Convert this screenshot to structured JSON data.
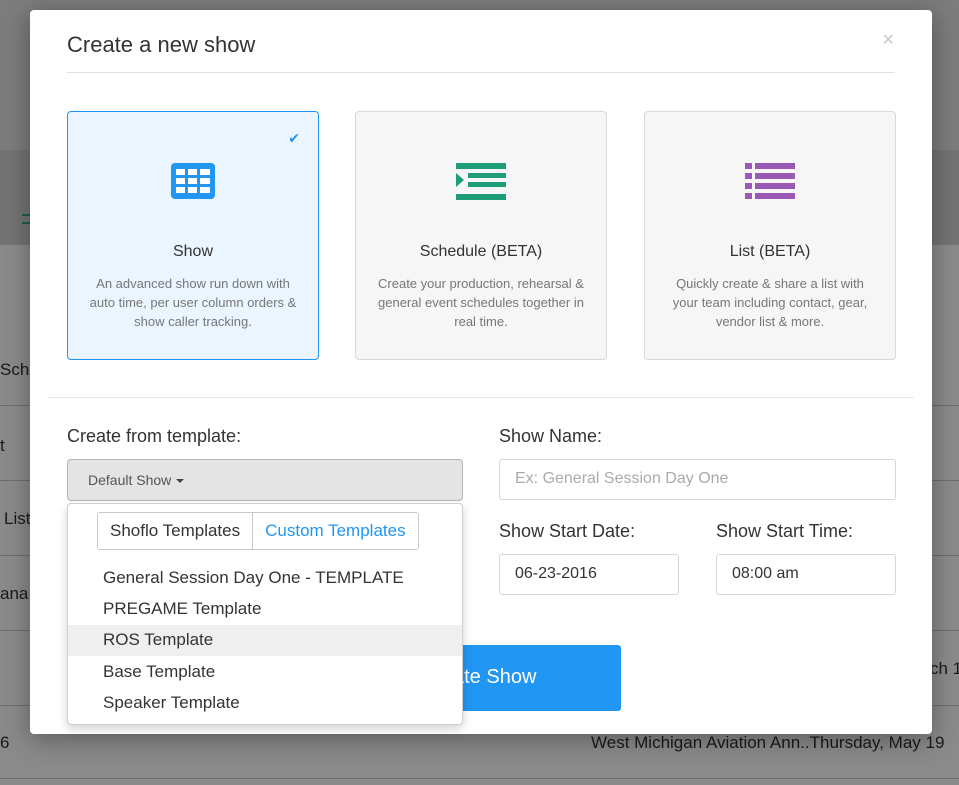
{
  "background": {
    "fragments": [
      "Sch",
      "t",
      "List",
      "ana",
      "ch 1",
      "6",
      "West Michigan Aviation Ann..Thursday, May 19"
    ]
  },
  "modal": {
    "title": "Create a new show",
    "close_label": "×"
  },
  "cards": [
    {
      "name": "Show",
      "description": "An advanced show run down with auto time, per user column orders & show caller tracking.",
      "icon": "grid-table-icon",
      "selected": true,
      "check": "✔"
    },
    {
      "name": "Schedule (BETA)",
      "description": "Create your production, rehearsal & general event schedules together in real time.",
      "icon": "schedule-list-icon",
      "selected": false
    },
    {
      "name": "List (BETA)",
      "description": "Quickly create & share a list with your team including contact, gear, vendor list & more.",
      "icon": "bullet-list-icon",
      "selected": false
    }
  ],
  "colors": {
    "accent": "#2196f3",
    "schedule_icon": "#1d9e79",
    "list_icon": "#9b59b6"
  },
  "template": {
    "label": "Create from template:",
    "selected": "Default Show",
    "tabs": [
      "Shoflo Templates",
      "Custom Templates"
    ],
    "items": [
      "General Session Day One - TEMPLATE",
      "PREGAME Template",
      "ROS Template",
      "Base Template",
      "Speaker Template"
    ],
    "highlighted_index": 2
  },
  "show_name": {
    "label": "Show Name:",
    "placeholder": "Ex: General Session Day One"
  },
  "start_date": {
    "label": "Show Start Date:",
    "value": "06-23-2016"
  },
  "start_time": {
    "label": "Show Start Time:",
    "value": "08:00 am"
  },
  "create_button": {
    "label_visible": "ate Show"
  }
}
